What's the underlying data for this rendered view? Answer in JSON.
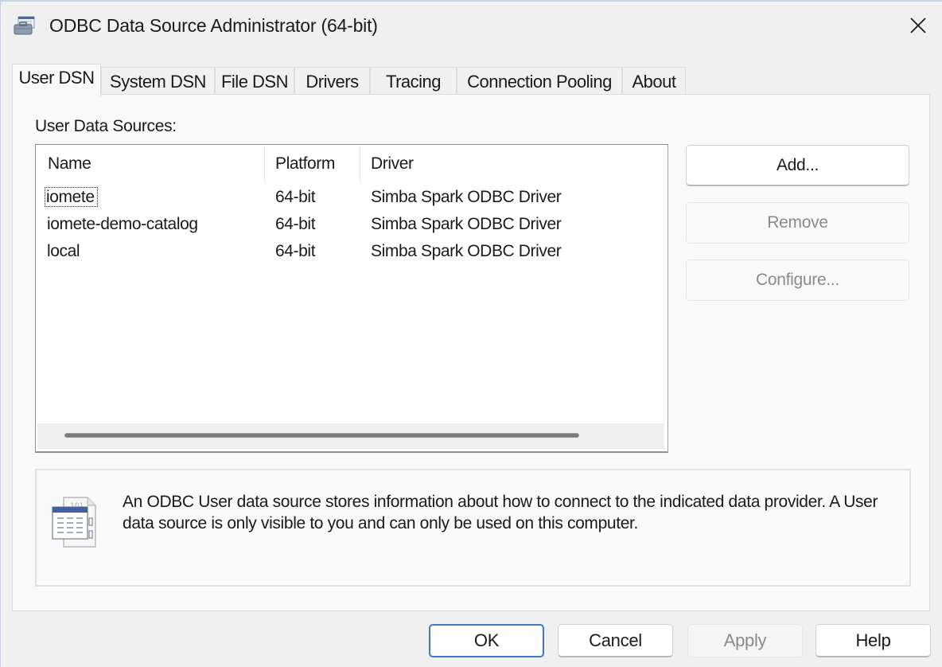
{
  "window": {
    "title": "ODBC Data Source Administrator (64-bit)",
    "app_icon": "odbc-admin-icon",
    "close_icon": "close-icon"
  },
  "tabs": [
    {
      "label": "User DSN",
      "active": true
    },
    {
      "label": "System DSN",
      "active": false
    },
    {
      "label": "File DSN",
      "active": false
    },
    {
      "label": "Drivers",
      "active": false
    },
    {
      "label": "Tracing",
      "active": false
    },
    {
      "label": "Connection Pooling",
      "active": false
    },
    {
      "label": "About",
      "active": false
    }
  ],
  "user_dsn": {
    "section_label": "User Data Sources:",
    "columns": [
      "Name",
      "Platform",
      "Driver"
    ],
    "rows": [
      {
        "name": "iomete",
        "platform": "64-bit",
        "driver": "Simba Spark ODBC Driver",
        "focused": true
      },
      {
        "name": "iomete-demo-catalog",
        "platform": "64-bit",
        "driver": "Simba Spark ODBC Driver",
        "focused": false
      },
      {
        "name": "local",
        "platform": "64-bit",
        "driver": "Simba Spark ODBC Driver",
        "focused": false
      }
    ],
    "buttons": {
      "add": {
        "label": "Add...",
        "enabled": true
      },
      "remove": {
        "label": "Remove",
        "enabled": false
      },
      "configure": {
        "label": "Configure...",
        "enabled": false
      }
    },
    "info": {
      "icon": "data-source-icon",
      "text": "An ODBC User data source stores information about how to connect to the indicated data provider.   A User data source is only visible to you and can only be used on this computer."
    }
  },
  "footer": {
    "ok": {
      "label": "OK",
      "enabled": true,
      "default": true
    },
    "cancel": {
      "label": "Cancel",
      "enabled": true
    },
    "apply": {
      "label": "Apply",
      "enabled": false
    },
    "help": {
      "label": "Help",
      "enabled": true
    }
  },
  "colors": {
    "default_button_border": "#3f7bc4",
    "disabled_text": "#8a8a8a"
  }
}
